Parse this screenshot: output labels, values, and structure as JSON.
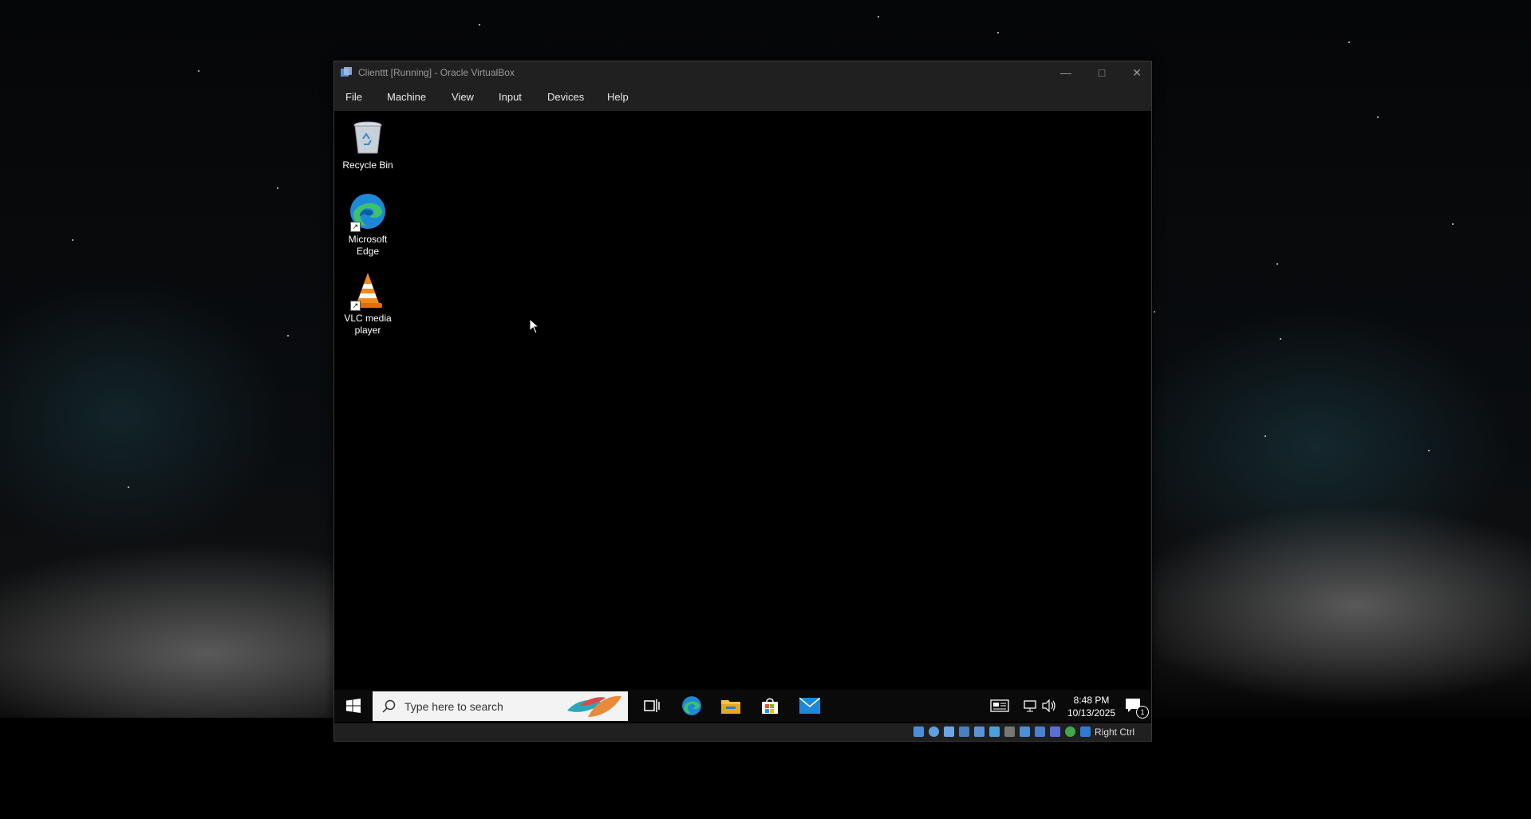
{
  "window": {
    "title": "Clienttt [Running] - Oracle VirtualBox",
    "controls": [
      "minimize-icon",
      "maximize-icon",
      "close-icon"
    ]
  },
  "menu": {
    "file": "File",
    "machine": "Machine",
    "view": "View",
    "input": "Input",
    "devices": "Devices",
    "help": "Help"
  },
  "desktop": {
    "icons": [
      {
        "label": "Recycle Bin",
        "icon": "recycle-bin-icon"
      },
      {
        "label": "Microsoft Edge",
        "icon": "edge-icon"
      },
      {
        "label": "VLC media player",
        "icon": "vlc-icon"
      }
    ]
  },
  "taskbar": {
    "search_placeholder": "Type here to search",
    "apps": [
      "task-view-icon",
      "edge-icon",
      "file-explorer-icon",
      "store-icon",
      "mail-icon"
    ],
    "time": "8:48 PM",
    "date": "10/13/2025",
    "notification_count": "1"
  },
  "statusbar": {
    "host_key": "Right Ctrl"
  },
  "colors": {
    "vm_background": "#000000",
    "window_chrome": "#202020",
    "edge_blue": "#1e88d8",
    "edge_green": "#3cc26e",
    "vlc_orange": "#f28a1a"
  }
}
